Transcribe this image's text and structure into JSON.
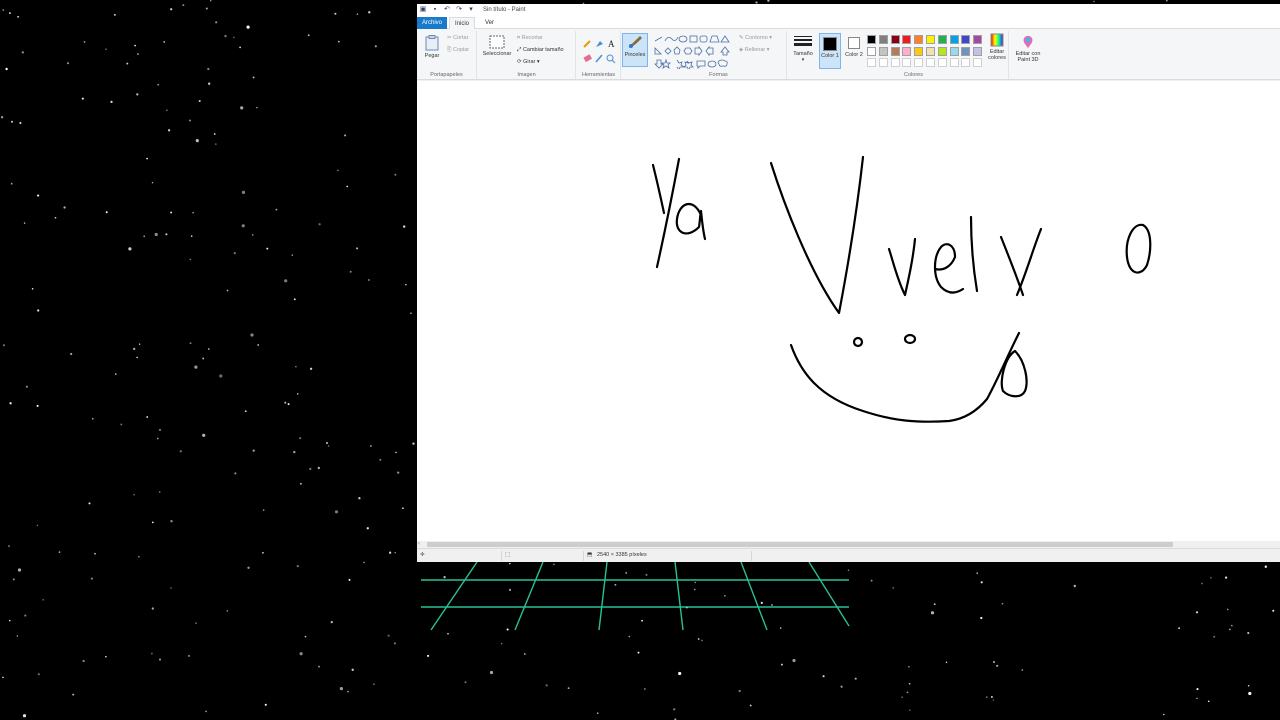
{
  "window": {
    "title": "Sin título - Paint"
  },
  "tabs": [
    "Archivo",
    "Inicio",
    "Ver"
  ],
  "ribbon": {
    "clipboard": {
      "paste": "Pegar",
      "cut": "Cortar",
      "copy": "Copiar",
      "label": "Portapapeles"
    },
    "image": {
      "select": "Seleccionar",
      "crop": "Recortar",
      "resize": "Cambiar tamaño",
      "rotate": "Girar",
      "label": "Imagen"
    },
    "tools": {
      "label": "Herramientas"
    },
    "brushes": {
      "label": "Pinceles"
    },
    "shapes": {
      "outline": "Contorno",
      "fill": "Rellenar",
      "label": "Formas"
    },
    "size": {
      "label": "Tamaño"
    },
    "colors": {
      "color1": "Color 1",
      "color2": "Color 2",
      "edit": "Editar colores",
      "label": "Colores",
      "palette_row1": [
        "#000000",
        "#7f7f7f",
        "#880015",
        "#ed1c24",
        "#ff7f27",
        "#fff200",
        "#22b14c",
        "#00a2e8",
        "#3f48cc",
        "#a349a4"
      ],
      "palette_row2": [
        "#ffffff",
        "#c3c3c3",
        "#b97a57",
        "#ffaec9",
        "#ffc90e",
        "#efe4b0",
        "#b5e61d",
        "#99d9ea",
        "#7092be",
        "#c8bfe7"
      ],
      "color1_value": "#000000",
      "color2_value": "#ffffff"
    },
    "paint3d": "Editar con Paint 3D"
  },
  "status": {
    "dimensions": "2540 × 3385 píxeles"
  }
}
